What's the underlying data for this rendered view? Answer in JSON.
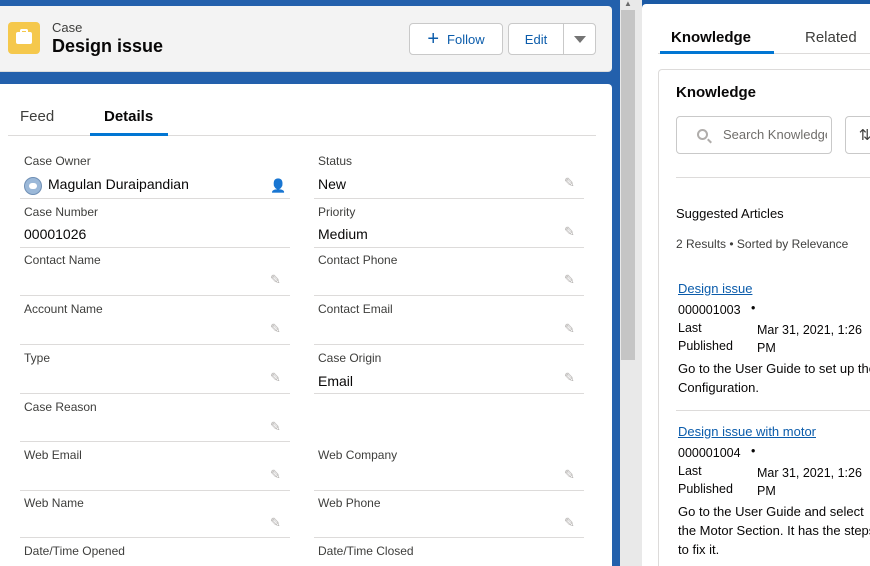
{
  "header": {
    "object_label": "Case",
    "record_title": "Design issue",
    "follow_label": "Follow",
    "edit_label": "Edit"
  },
  "tabs": [
    {
      "label": "Feed"
    },
    {
      "label": "Details"
    }
  ],
  "fields": {
    "case_owner": {
      "label": "Case Owner",
      "value": "Magulan Duraipandian"
    },
    "status": {
      "label": "Status",
      "value": "New"
    },
    "case_number": {
      "label": "Case Number",
      "value": "00001026"
    },
    "priority": {
      "label": "Priority",
      "value": "Medium"
    },
    "contact_name": {
      "label": "Contact Name",
      "value": ""
    },
    "contact_phone": {
      "label": "Contact Phone",
      "value": ""
    },
    "account_name": {
      "label": "Account Name",
      "value": ""
    },
    "contact_email": {
      "label": "Contact Email",
      "value": ""
    },
    "type": {
      "label": "Type",
      "value": ""
    },
    "case_origin": {
      "label": "Case Origin",
      "value": "Email"
    },
    "case_reason": {
      "label": "Case Reason",
      "value": ""
    },
    "web_email": {
      "label": "Web Email",
      "value": ""
    },
    "web_company": {
      "label": "Web Company",
      "value": ""
    },
    "web_name": {
      "label": "Web Name",
      "value": ""
    },
    "web_phone": {
      "label": "Web Phone",
      "value": ""
    },
    "date_opened": {
      "label": "Date/Time Opened",
      "value": ""
    },
    "date_closed": {
      "label": "Date/Time Closed",
      "value": ""
    }
  },
  "right_tabs": [
    {
      "label": "Knowledge"
    },
    {
      "label": "Related"
    }
  ],
  "knowledge": {
    "title": "Knowledge",
    "search_placeholder": "Search Knowledge...",
    "suggested_label": "Suggested Articles",
    "results_text": "2 Results • Sorted by Relevance",
    "articles": [
      {
        "title": "Design issue",
        "number": "000001003",
        "dot": "•",
        "last": "Last",
        "published": "Published",
        "date": "Mar 31, 2021, 1:26 PM",
        "summary": "Go to the User Guide to set up the Configuration."
      },
      {
        "title": "Design issue with motor",
        "number": "000001004",
        "dot": "•",
        "last": "Last",
        "published": "Published",
        "date": "Mar 31, 2021, 1:26 PM",
        "summary": "Go to the User Guide and select the Motor Section. It has the steps to fix it."
      }
    ]
  },
  "icons": {
    "case": "briefcase-icon",
    "follow": "plus-icon",
    "menu": "chevron-down-icon",
    "edit": "pencil-icon",
    "search": "search-icon",
    "sort": "sort-icon"
  },
  "colors": {
    "brand_blue": "#0176d3",
    "link_blue": "#0b5cab",
    "case_icon": "#f5c84c",
    "background": "#2360ac"
  }
}
